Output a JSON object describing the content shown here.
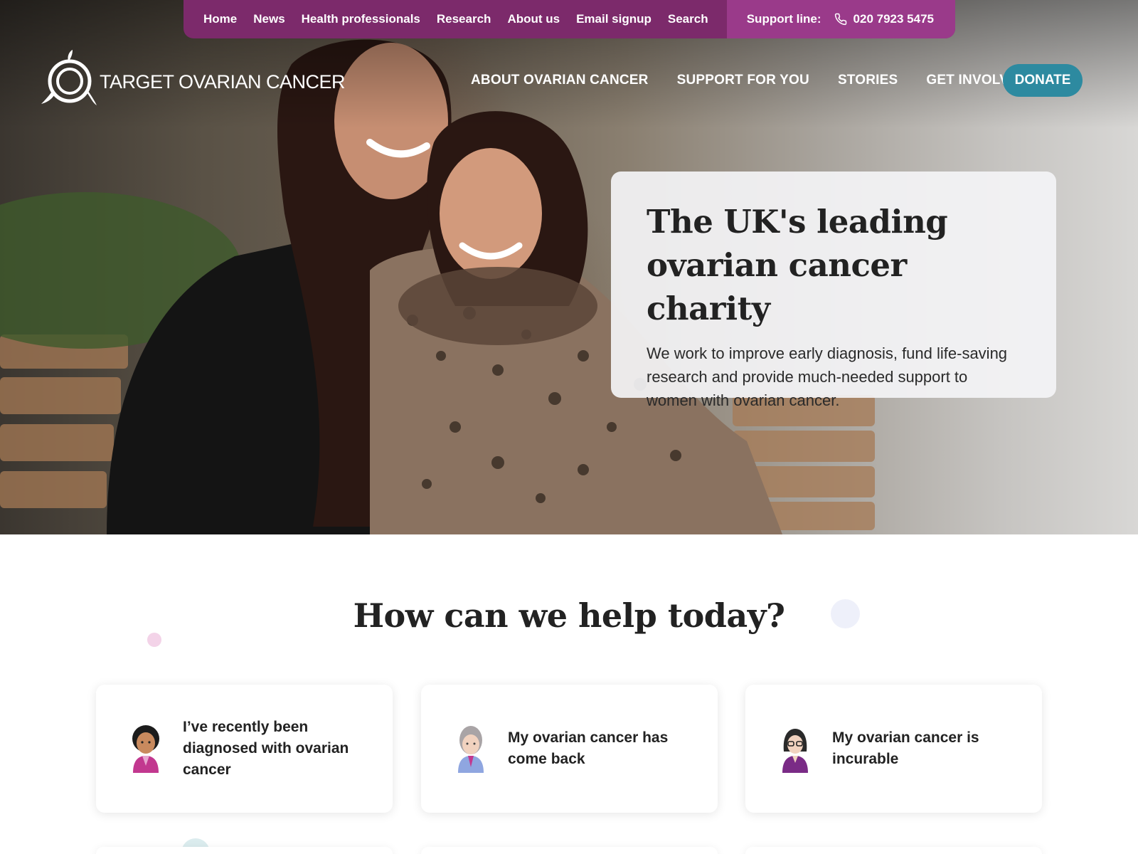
{
  "utility_nav": {
    "links": [
      "Home",
      "News",
      "Health professionals",
      "Research",
      "About us",
      "Email signup",
      "Search"
    ],
    "support_label": "Support line:",
    "support_icon": "phone-icon",
    "support_phone": "020 7923 5475"
  },
  "header": {
    "logo_text": "TARGET OVARIAN CANCER",
    "nav": [
      "ABOUT OVARIAN CANCER",
      "SUPPORT FOR YOU",
      "STORIES",
      "GET INVOLVED"
    ],
    "donate_label": "DONATE"
  },
  "hero": {
    "title": "The UK's leading ovarian cancer charity",
    "text": "We work to improve early diagnosis, fund life-saving research and provide much-needed support to women with ovarian cancer."
  },
  "help": {
    "title": "How can we help today?",
    "cards": [
      {
        "label": "I’ve recently been diagnosed with ovarian cancer",
        "icon": "woman-avatar-icon"
      },
      {
        "label": "My ovarian cancer has come back",
        "icon": "woman-avatar-icon"
      },
      {
        "label": "My ovarian cancer is incurable",
        "icon": "woman-avatar-icon"
      }
    ]
  },
  "colors": {
    "utility_bar": "#7c2a6b",
    "support_block": "#9a3a8a",
    "donate": "#2d8aa0",
    "text_dark": "#222222"
  }
}
